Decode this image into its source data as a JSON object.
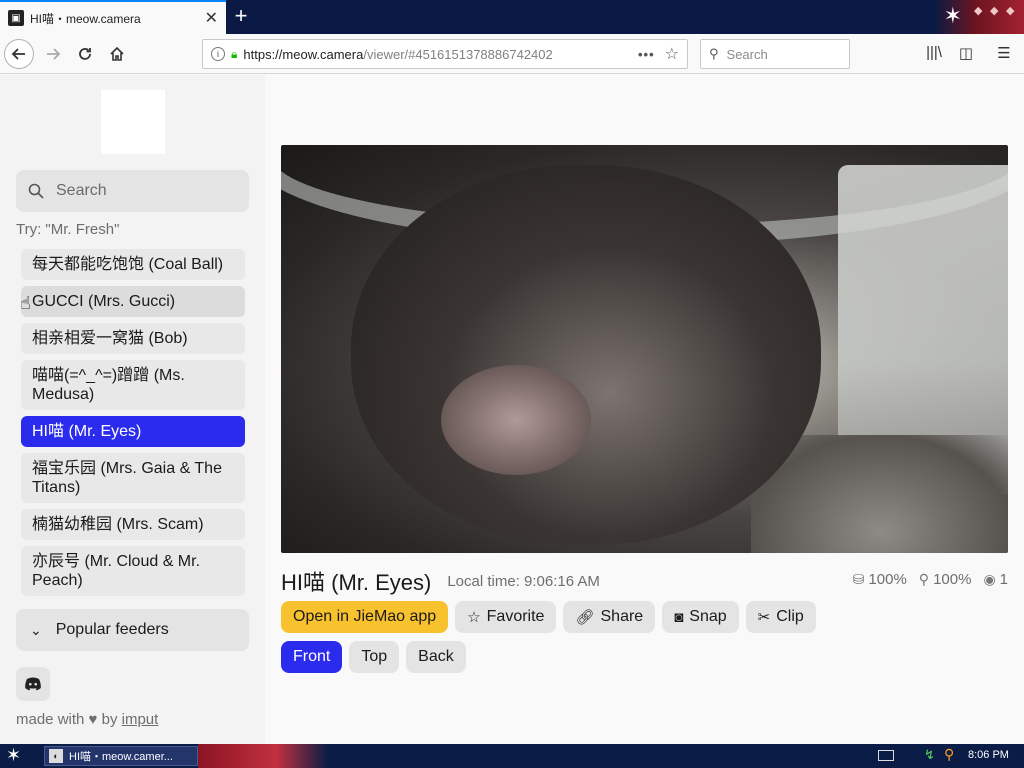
{
  "browser": {
    "tab_title": "HI喵・meow.camera",
    "url_host": "https://meow.camera",
    "url_path": "/viewer/#4516151378886742402",
    "search_placeholder": "Search"
  },
  "sidebar": {
    "search_placeholder": "Search",
    "try_hint": "Try: \"Mr. Fresh\"",
    "cameras": [
      {
        "label": "每天都能吃饱饱 (Coal Ball)",
        "active": false
      },
      {
        "label": "GUCCI (Mrs. Gucci)",
        "active": false
      },
      {
        "label": "相亲相爱一窝猫 (Bob)",
        "active": false
      },
      {
        "label": "喵喵(=^_^=)蹭蹭 (Ms. Medusa)",
        "active": false
      },
      {
        "label": "HI喵 (Mr. Eyes)",
        "active": true
      },
      {
        "label": "福宝乐园 (Mrs. Gaia & The Titans)",
        "active": false
      },
      {
        "label": "楠猫幼稚园 (Mrs. Scam)",
        "active": false
      },
      {
        "label": "亦辰号 (Mr. Cloud & Mr. Peach)",
        "active": false
      }
    ],
    "popular_label": "Popular feeders",
    "credit_prefix": "made with",
    "credit_by": "by",
    "credit_link": "imput"
  },
  "viewer": {
    "cam_name": "HI喵 (Mr. Eyes)",
    "local_time": "Local time: 9:06:16 AM",
    "food_level": "100%",
    "scoop_level": "100%",
    "viewers": "1",
    "actions": {
      "open_app": "Open in JieMao app",
      "favorite": "Favorite",
      "share": "Share",
      "snap": "Snap",
      "clip": "Clip"
    },
    "views": {
      "front": "Front",
      "top": "Top",
      "back": "Back"
    }
  },
  "taskbar": {
    "task_label": "HI喵・meow.camer...",
    "clock": "8:06 PM"
  },
  "colors": {
    "accent": "#2b2bee",
    "app_button": "#f8c12e",
    "lock": "#12bc00"
  }
}
